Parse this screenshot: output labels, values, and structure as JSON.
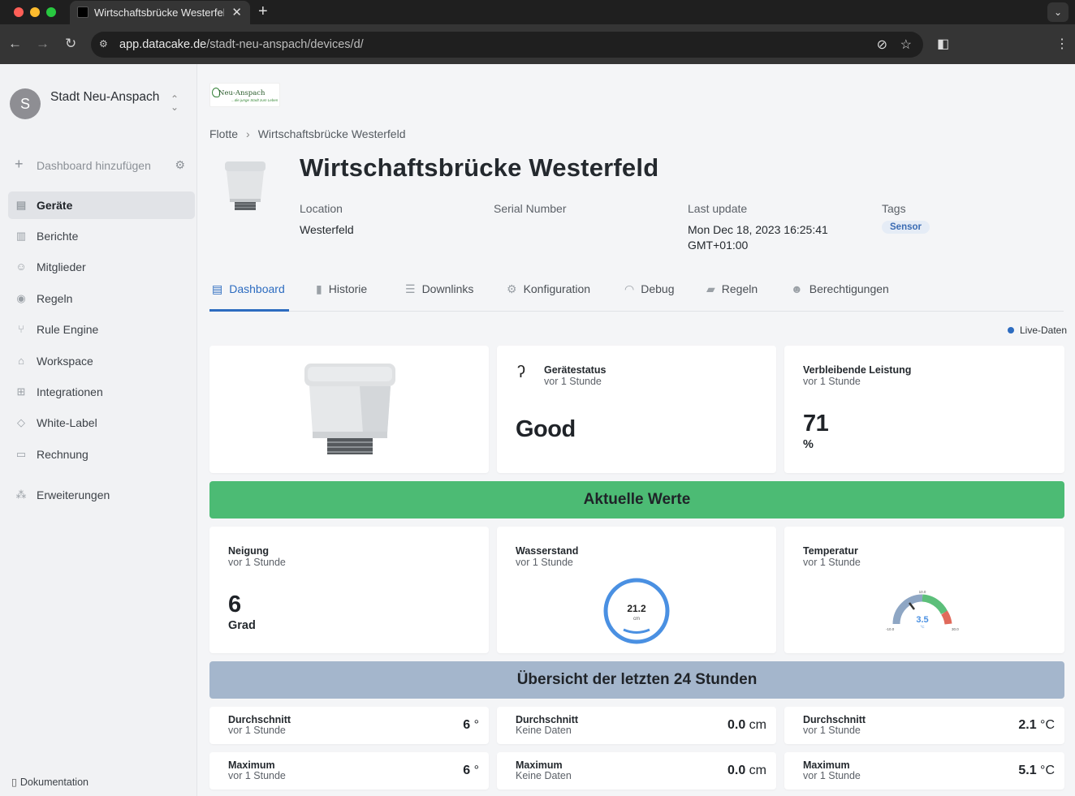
{
  "browser": {
    "tab_title": "Wirtschaftsbrücke Westerfeld",
    "url_host": "app.datacake.de",
    "url_path": "/stadt-neu-anspach/devices/d/"
  },
  "sidebar": {
    "org_initial": "S",
    "org_name": "Stadt Neu-Anspach",
    "add_dashboard": "Dashboard hinzufügen",
    "items": [
      {
        "label": "Geräte",
        "icon": "devices-icon"
      },
      {
        "label": "Berichte",
        "icon": "report-icon"
      },
      {
        "label": "Mitglieder",
        "icon": "members-icon"
      },
      {
        "label": "Regeln",
        "icon": "rules-icon"
      },
      {
        "label": "Rule Engine",
        "icon": "rule-engine-icon"
      },
      {
        "label": "Workspace",
        "icon": "workspace-icon"
      },
      {
        "label": "Integrationen",
        "icon": "integrations-icon"
      },
      {
        "label": "White-Label",
        "icon": "tag-icon"
      },
      {
        "label": "Rechnung",
        "icon": "billing-icon"
      },
      {
        "label": "Erweiterungen",
        "icon": "extensions-icon"
      }
    ],
    "docs": "Dokumentation"
  },
  "logo": {
    "name": "Neu-Anspach",
    "slogan": "...die junge Stadt zum Leben"
  },
  "breadcrumb": {
    "root": "Flotte",
    "current": "Wirtschaftsbrücke Westerfeld"
  },
  "device": {
    "title": "Wirtschaftsbrücke Westerfeld",
    "location_label": "Location",
    "location_value": "Westerfeld",
    "serial_label": "Serial Number",
    "serial_value": "",
    "last_update_label": "Last update",
    "last_update_value1": "Mon Dec 18, 2023 16:25:41",
    "last_update_value2": "GMT+01:00",
    "tags_label": "Tags",
    "tag": "Sensor"
  },
  "tabs": [
    "Dashboard",
    "Historie",
    "Downlinks",
    "Konfiguration",
    "Debug",
    "Regeln",
    "Berechtigungen"
  ],
  "live": "Live-Daten",
  "widgets": {
    "status": {
      "title": "Gerätestatus",
      "sub": "vor 1 Stunde",
      "value": "Good"
    },
    "power": {
      "title": "Verbleibende Leistung",
      "sub": "vor 1 Stunde",
      "value": "71",
      "unit": "%"
    },
    "current_banner": "Aktuelle Werte",
    "neigung": {
      "title": "Neigung",
      "sub": "vor 1 Stunde",
      "value": "6",
      "unit": "Grad"
    },
    "wasser": {
      "title": "Wasserstand",
      "sub": "vor 1 Stunde",
      "value": "21.2",
      "unit": "cm"
    },
    "temp": {
      "title": "Temperatur",
      "sub": "vor 1 Stunde",
      "value": "3.5",
      "unit": "°C",
      "min": "-10.0",
      "mid": "10.0",
      "max": "30.0"
    },
    "overview_banner": "Übersicht der letzten 24 Stunden",
    "stats": [
      {
        "title": "Durchschnitt",
        "sub": "vor 1 Stunde",
        "value": "6",
        "unit": "°"
      },
      {
        "title": "Durchschnitt",
        "sub": "Keine Daten",
        "value": "0.0",
        "unit": "cm"
      },
      {
        "title": "Durchschnitt",
        "sub": "vor 1 Stunde",
        "value": "2.1",
        "unit": "°C"
      },
      {
        "title": "Maximum",
        "sub": "vor 1 Stunde",
        "value": "6",
        "unit": "°"
      },
      {
        "title": "Maximum",
        "sub": "Keine Daten",
        "value": "0.0",
        "unit": "cm"
      },
      {
        "title": "Maximum",
        "sub": "vor 1 Stunde",
        "value": "5.1",
        "unit": "°C"
      }
    ]
  },
  "colors": {
    "accent": "#2d6cc0",
    "green_banner": "#4cbb74",
    "grey_banner": "#a4b6cc"
  }
}
